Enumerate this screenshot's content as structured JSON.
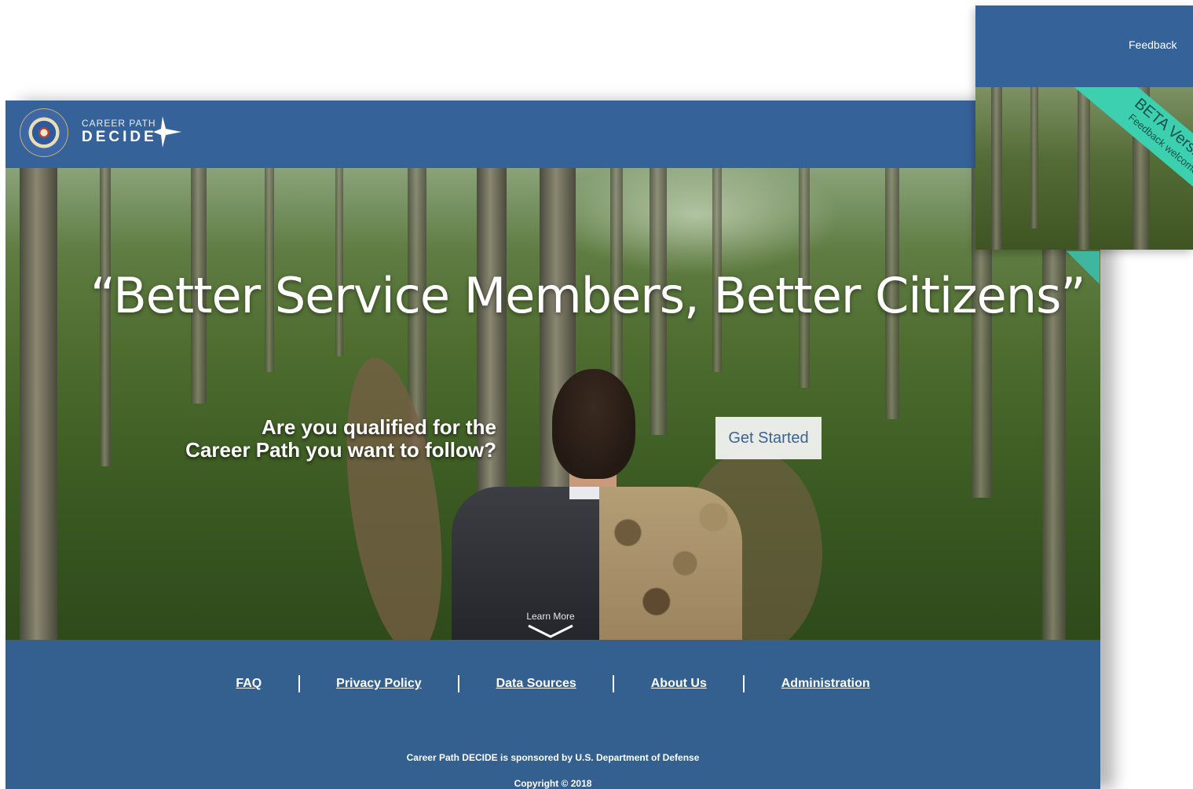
{
  "brand": {
    "small": "CAREER PATH",
    "big": "DECIDE"
  },
  "hero": {
    "title": "“Better Service Members, Better Citizens”",
    "question_line1": "Are you qualified for the",
    "question_line2": "Career Path you want to follow?",
    "cta_label": "Get Started",
    "learn_more_label": "Learn More"
  },
  "footer": {
    "links": [
      "FAQ",
      "Privacy Policy",
      "Data Sources",
      "About Us",
      "Administration"
    ],
    "sponsor": "Career Path DECIDE is sponsored by U.S. Department of Defense",
    "copyright": "Copyright © 2018"
  },
  "snippet": {
    "feedback_label": "Feedback",
    "beta_main": "BETA Version",
    "beta_sub": "Feedback welcome"
  },
  "colors": {
    "header_blue": "#36629a",
    "footer_blue": "#34608f",
    "ribbon_teal": "#3cd0b0",
    "cta_text": "#3b6396"
  },
  "icons": [
    "dod-seal-icon",
    "compass-arrow-icon",
    "chevron-down-icon"
  ]
}
